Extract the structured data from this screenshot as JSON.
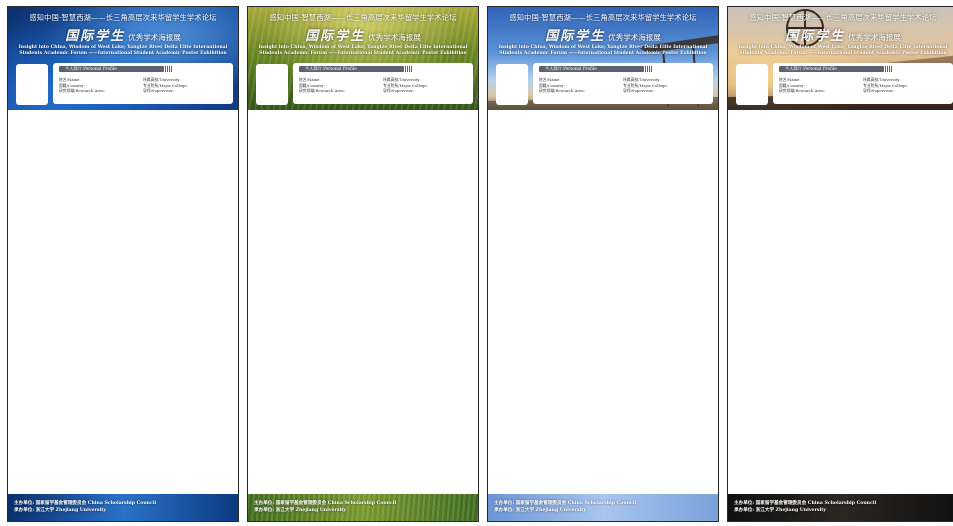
{
  "poster_text": {
    "title_cn": "感知中国·智慧西湖——长三角高层次来华留学生学术论坛",
    "title_main_big": "国际学生",
    "title_main_small": "优秀学术海报展",
    "title_en": "Insight into China, Wisdom of West Lake; Yangtze River Delta Elite International Students Academic Forum ——International Student Academic Poster Exhibition",
    "profile_tab": "个人简介 Personal Profile",
    "field_name": "姓名/Name:",
    "field_country": "国籍/Country:",
    "field_research": "研究领域/Research Area:",
    "field_university": "所属高校/University:",
    "field_major": "专业院系/Major College:",
    "field_supervisor": "导师/Supervisor:",
    "footer_organizer": "主办单位: 国家留学基金管理委员会  China Scholarship Council",
    "footer_host": "承办单位: 浙江大学  Zhejiang University"
  },
  "themes": [
    {
      "id": "blue",
      "accent": "#1c5cb4"
    },
    {
      "id": "green",
      "accent": "#5d7f22"
    },
    {
      "id": "sky",
      "accent": "#5d93d8"
    },
    {
      "id": "sunset",
      "accent": "#b48a62"
    }
  ]
}
